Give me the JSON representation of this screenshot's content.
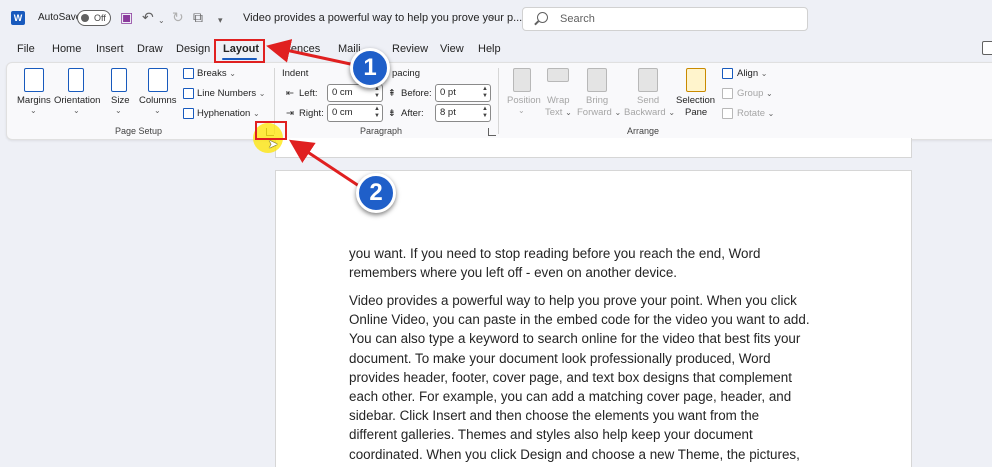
{
  "titlebar": {
    "logo": "W",
    "autosave_label": "AutoSave",
    "autosave_state": "Off",
    "doc_title": "Video provides a powerful way to help you prove your p...",
    "search_placeholder": "Search",
    "icons": [
      "save-icon",
      "undo-icon",
      "redo-icon",
      "touch-mode-icon",
      "customize-icon"
    ]
  },
  "menu": {
    "tabs": [
      "File",
      "Home",
      "Insert",
      "Draw",
      "Design",
      "Layout",
      "References",
      "Mailings",
      "Review",
      "View",
      "Help"
    ],
    "tab_visible": [
      "File",
      "Home",
      "Insert",
      "Draw",
      "Design",
      "Layout",
      "ferences",
      "Maili",
      "Review",
      "View",
      "Help"
    ],
    "active": "Layout"
  },
  "ribbon": {
    "page_setup": {
      "label": "Page Setup",
      "margins": "Margins",
      "orientation": "Orientation",
      "size": "Size",
      "columns": "Columns",
      "breaks": "Breaks",
      "line_numbers": "Line Numbers",
      "hyphenation": "Hyphenation"
    },
    "paragraph": {
      "label": "Paragraph",
      "indent_header": "Indent",
      "spacing_header": "pacing",
      "left_label": "Left:",
      "left_value": "0 cm",
      "right_label": "Right:",
      "right_value": "0 cm",
      "before_label": "Before:",
      "before_value": "0 pt",
      "after_label": "After:",
      "after_value": "8 pt"
    },
    "arrange": {
      "label": "Arrange",
      "position": "Position",
      "wrap_1": "Wrap",
      "wrap_2": "Text",
      "bring_1": "Bring",
      "bring_2": "Forward",
      "send_1": "Send",
      "send_2": "Backward",
      "selection_1": "Selection",
      "selection_2": "Pane",
      "align": "Align",
      "group": "Group",
      "rotate": "Rotate"
    }
  },
  "document": {
    "paragraph_1": [
      "you want. If you need to stop reading before you reach the end, Word",
      "remembers where you left off - even on another device."
    ],
    "paragraph_2": [
      "Video provides a powerful way to help you prove your point. When you click",
      "Online Video, you can paste in the embed code for the video you want to add.",
      "You can also type a keyword to search online for the video that best fits your",
      "document. To make your document look professionally produced, Word",
      "provides header, footer, cover page, and text box designs that complement",
      "each other. For example, you can add a matching cover page, header, and",
      "sidebar. Click Insert and then choose the elements you want from the",
      "different galleries. Themes and styles also help keep your document",
      "coordinated. When you click Design and choose a new Theme, the pictures,"
    ]
  },
  "annotations": {
    "step_1": "1",
    "step_2": "2",
    "highlight_color": "#e02020",
    "badge_color": "#1f5fc9"
  }
}
